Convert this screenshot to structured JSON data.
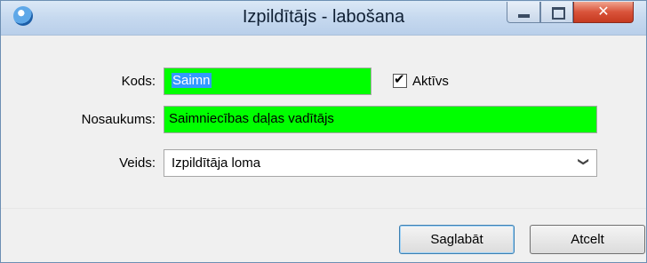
{
  "window": {
    "title": "Izpildītājs - labošana",
    "close_glyph": "✕",
    "colors": {
      "field_highlight": "#00ff00",
      "selection": "#3399ff",
      "titlebar": "#c6d9ef"
    }
  },
  "form": {
    "kods_label": "Kods:",
    "kods_value": "Saimn",
    "aktivs_label": "Aktīvs",
    "aktivs_checked": true,
    "nosaukums_label": "Nosaukums:",
    "nosaukums_value": "Saimniecības daļas vadītājs",
    "veids_label": "Veids:",
    "veids_value": "Izpildītāja loma"
  },
  "buttons": {
    "save_label": "Saglabāt",
    "cancel_label": "Atcelt"
  },
  "icons": {
    "app": "app-globe-icon",
    "minimize": "minimize-icon",
    "maximize": "maximize-icon",
    "close": "close-icon",
    "check": "checkmark-icon",
    "dropdown": "chevron-down-icon"
  }
}
